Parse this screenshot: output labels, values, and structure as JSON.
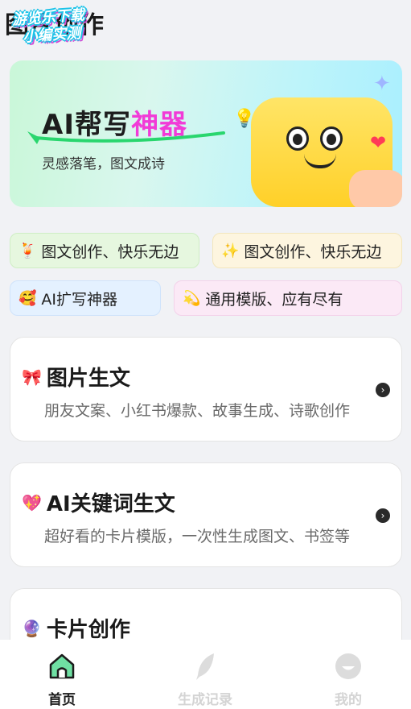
{
  "header": {
    "title": "图片创作",
    "watermark_line1": "游览乐下载",
    "watermark_line2": "小编实测"
  },
  "banner": {
    "title_part1": "AI帮写",
    "title_part2": "神器",
    "subtitle": "灵感落笔，图文成诗"
  },
  "chips": [
    {
      "emoji": "🍹",
      "label": "图文创作、快乐无边"
    },
    {
      "emoji": "✨",
      "label": "图文创作、快乐无边"
    },
    {
      "emoji": "🥰",
      "label": "AI扩写神器"
    },
    {
      "emoji": "💫",
      "label": "通用模版、应有尽有"
    }
  ],
  "cards": [
    {
      "emoji": "🎀",
      "title": "图片生文",
      "desc": "朋友文案、小红书爆款、故事生成、诗歌创作"
    },
    {
      "emoji": "💖",
      "title": "AI关键词生文",
      "desc": "超好看的卡片模版，一次性生成图文、书签等"
    },
    {
      "emoji": "🔮",
      "title": "卡片创作",
      "desc": ""
    }
  ],
  "tabbar": {
    "home_label": "首页",
    "history_label": "生成记录",
    "mine_label": "我的",
    "active": "home"
  },
  "colors": {
    "accent_pink": "#f13bd7",
    "home_icon": "#1fa66b",
    "inactive": "#d4d4d4"
  },
  "icons": {
    "home": "home-icon",
    "history": "feather-icon",
    "mine": "smile-face-icon",
    "card_arrow": "chevron-right-icon"
  }
}
